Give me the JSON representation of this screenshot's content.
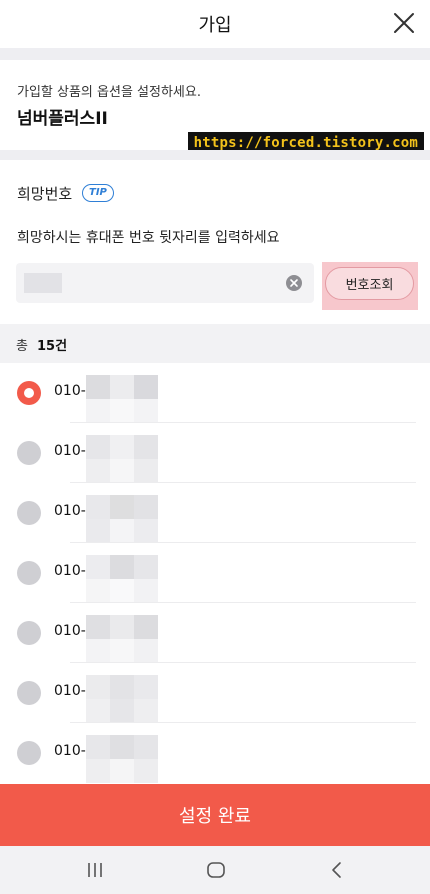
{
  "header": {
    "title": "가입",
    "close_icon": "close-icon"
  },
  "product": {
    "subtitle": "가입할 상품의 옵션을 설정하세요.",
    "name": "넘버플러스II",
    "watermark": "https://forced.tistory.com"
  },
  "wish_number": {
    "label": "희망번호",
    "tip_badge": "TIP",
    "help_text": "희망하시는 휴대폰 번호 뒷자리를 입력하세요",
    "input_value": "",
    "search_button": "번호조회",
    "highlight_color": "#f7c7cc"
  },
  "result": {
    "total_label": "총",
    "total_count": "15건",
    "items": [
      {
        "prefix": "010-",
        "selected": true
      },
      {
        "prefix": "010-",
        "selected": false
      },
      {
        "prefix": "010-",
        "selected": false
      },
      {
        "prefix": "010-",
        "selected": false
      },
      {
        "prefix": "010-",
        "selected": false
      },
      {
        "prefix": "010-",
        "selected": false
      },
      {
        "prefix": "010-",
        "selected": false
      }
    ]
  },
  "footer": {
    "submit_button": "설정 완료"
  },
  "system_nav": {
    "recent": "recent-apps-icon",
    "home": "home-icon",
    "back": "back-icon"
  },
  "colors": {
    "accent": "#f25a4a",
    "tip_blue": "#2f7fd6"
  }
}
